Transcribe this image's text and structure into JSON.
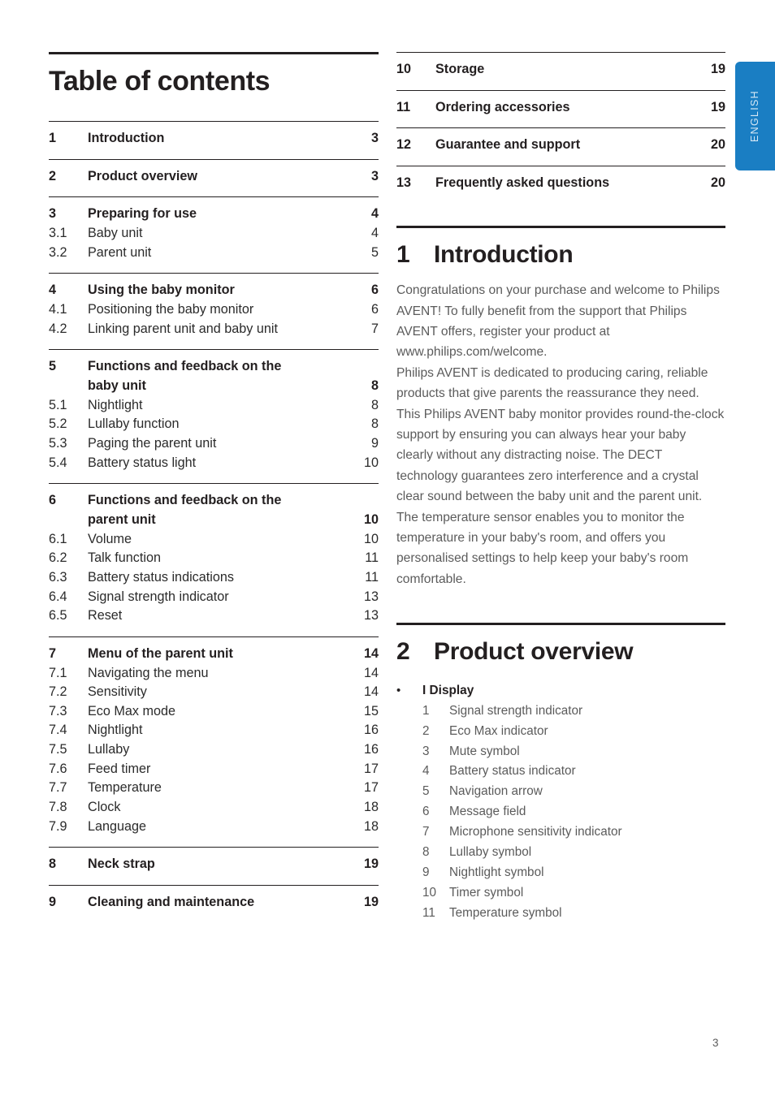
{
  "language_tab": {
    "label": "ENGLISH",
    "color": "#1a7ec3"
  },
  "left_column": {
    "title": "Table of contents",
    "toc_groups": [
      {
        "rows": [
          {
            "num": "1",
            "label": "Introduction",
            "page": "3",
            "level": 1
          }
        ]
      },
      {
        "rows": [
          {
            "num": "2",
            "label": "Product overview",
            "page": "3",
            "level": 1
          }
        ]
      },
      {
        "rows": [
          {
            "num": "3",
            "label": "Preparing for use",
            "page": "4",
            "level": 1
          },
          {
            "num": "3.1",
            "label": "Baby unit",
            "page": "4",
            "level": 2
          },
          {
            "num": "3.2",
            "label": "Parent unit",
            "page": "5",
            "level": 2
          }
        ]
      },
      {
        "rows": [
          {
            "num": "4",
            "label": "Using the baby monitor",
            "page": "6",
            "level": 1
          },
          {
            "num": "4.1",
            "label": "Positioning the baby monitor",
            "page": "6",
            "level": 2
          },
          {
            "num": "4.2",
            "label": "Linking parent unit and baby unit",
            "page": "7",
            "level": 2
          }
        ]
      },
      {
        "rows": [
          {
            "num": "5",
            "label_line1": "Functions and feedback on the",
            "label_line2": "baby unit",
            "page": "8",
            "level": 1
          },
          {
            "num": "5.1",
            "label": "Nightlight",
            "page": "8",
            "level": 2
          },
          {
            "num": "5.2",
            "label": "Lullaby function",
            "page": "8",
            "level": 2
          },
          {
            "num": "5.3",
            "label": "Paging the parent unit",
            "page": "9",
            "level": 2
          },
          {
            "num": "5.4",
            "label": "Battery status light",
            "page": "10",
            "level": 2
          }
        ]
      },
      {
        "rows": [
          {
            "num": "6",
            "label_line1": "Functions and feedback on the",
            "label_line2": "parent unit",
            "page": "10",
            "level": 1
          },
          {
            "num": "6.1",
            "label": "Volume",
            "page": "10",
            "level": 2
          },
          {
            "num": "6.2",
            "label": "Talk function",
            "page": "11",
            "level": 2
          },
          {
            "num": "6.3",
            "label": "Battery status indications",
            "page": "11",
            "level": 2
          },
          {
            "num": "6.4",
            "label": "Signal strength indicator",
            "page": "13",
            "level": 2
          },
          {
            "num": "6.5",
            "label": "Reset",
            "page": "13",
            "level": 2
          }
        ]
      },
      {
        "rows": [
          {
            "num": "7",
            "label": "Menu of the parent unit",
            "page": "14",
            "level": 1
          },
          {
            "num": "7.1",
            "label": "Navigating the menu",
            "page": "14",
            "level": 2
          },
          {
            "num": "7.2",
            "label": "Sensitivity",
            "page": "14",
            "level": 2
          },
          {
            "num": "7.3",
            "label": "Eco Max mode",
            "page": "15",
            "level": 2
          },
          {
            "num": "7.4",
            "label": "Nightlight",
            "page": "16",
            "level": 2
          },
          {
            "num": "7.5",
            "label": "Lullaby",
            "page": "16",
            "level": 2
          },
          {
            "num": "7.6",
            "label": "Feed timer",
            "page": "17",
            "level": 2
          },
          {
            "num": "7.7",
            "label": "Temperature",
            "page": "17",
            "level": 2
          },
          {
            "num": "7.8",
            "label": "Clock",
            "page": "18",
            "level": 2
          },
          {
            "num": "7.9",
            "label": "Language",
            "page": "18",
            "level": 2
          }
        ]
      },
      {
        "rows": [
          {
            "num": "8",
            "label": "Neck strap",
            "page": "19",
            "level": 1
          }
        ]
      },
      {
        "rows": [
          {
            "num": "9",
            "label": "Cleaning and maintenance",
            "page": "19",
            "level": 1
          }
        ]
      }
    ]
  },
  "right_column": {
    "toc_groups": [
      {
        "rows": [
          {
            "num": "10",
            "label": "Storage",
            "page": "19",
            "level": 1
          }
        ]
      },
      {
        "rows": [
          {
            "num": "11",
            "label": "Ordering accessories",
            "page": "19",
            "level": 1
          }
        ]
      },
      {
        "rows": [
          {
            "num": "12",
            "label": "Guarantee and support",
            "page": "20",
            "level": 1
          }
        ]
      },
      {
        "rows": [
          {
            "num": "13",
            "label": "Frequently asked questions",
            "page": "20",
            "level": 1
          }
        ]
      }
    ],
    "section_introduction": {
      "num": "1",
      "title": "Introduction",
      "paragraphs": [
        "Congratulations on your purchase and welcome to Philips AVENT! To fully benefit from the support that Philips AVENT offers, register your product at www.philips.com/welcome.",
        "Philips AVENT is dedicated to producing caring, reliable products that give parents the reassurance they need. This Philips AVENT baby monitor provides round-the-clock support by ensuring you can always hear your baby clearly without any distracting noise. The DECT technology guarantees zero interference and a crystal clear sound between the baby unit and the parent unit.",
        "The temperature sensor enables you to monitor the temperature in your baby's room, and offers you personalised settings to help keep your baby's room comfortable."
      ]
    },
    "section_product_overview": {
      "num": "2",
      "title": "Product overview",
      "bullet_symbol": "•",
      "bullet_label": "I Display",
      "items": [
        {
          "n": "1",
          "label": "Signal strength indicator"
        },
        {
          "n": "2",
          "label": "Eco Max indicator"
        },
        {
          "n": "3",
          "label": "Mute symbol"
        },
        {
          "n": "4",
          "label": "Battery status indicator"
        },
        {
          "n": "5",
          "label": "Navigation arrow"
        },
        {
          "n": "6",
          "label": "Message field"
        },
        {
          "n": "7",
          "label": "Microphone sensitivity indicator"
        },
        {
          "n": "8",
          "label": "Lullaby symbol"
        },
        {
          "n": "9",
          "label": "Nightlight symbol"
        },
        {
          "n": "10",
          "label": "Timer symbol"
        },
        {
          "n": "11",
          "label": "Temperature symbol"
        }
      ]
    }
  },
  "footer": {
    "page_number": "3"
  }
}
